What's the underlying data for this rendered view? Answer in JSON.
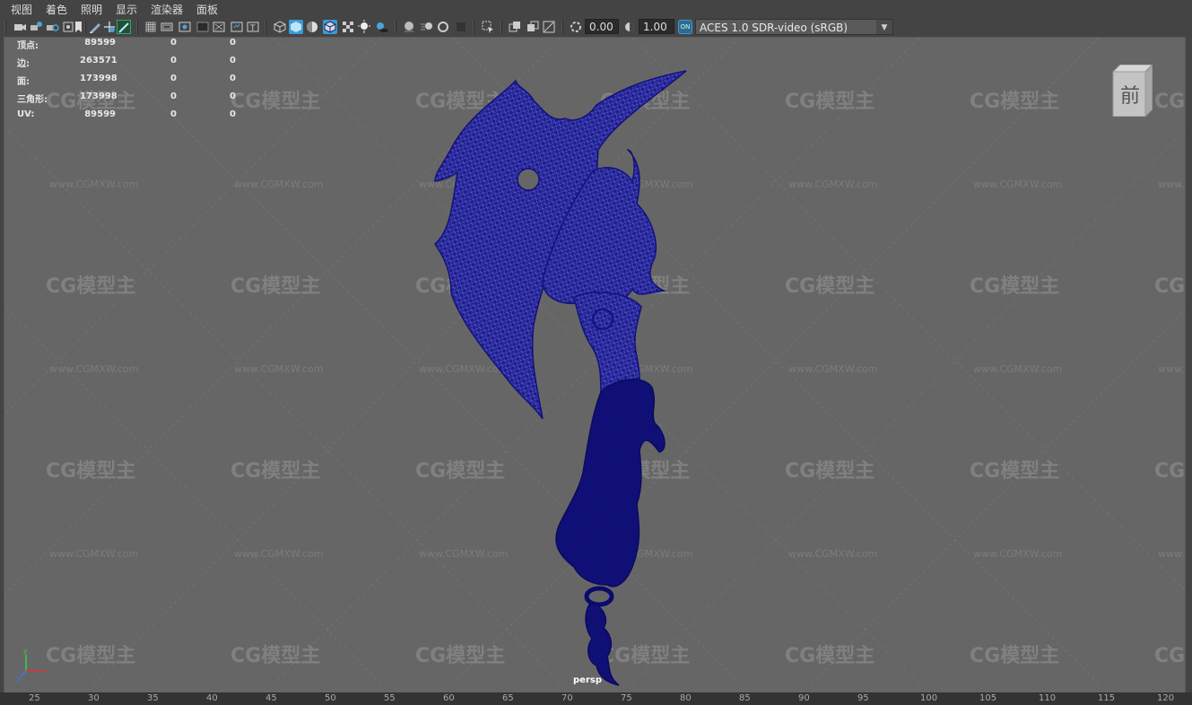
{
  "menu": [
    "视图",
    "着色",
    "照明",
    "显示",
    "渲染器",
    "面板"
  ],
  "toolbar": {
    "exposure": "0.00",
    "gamma": "1.00",
    "colorspace": "ACES 1.0 SDR-video (sRGB)",
    "on_badge": "ON"
  },
  "hud": [
    {
      "label": "顶点:",
      "values": [
        "89599",
        "0",
        "0"
      ]
    },
    {
      "label": "边:",
      "values": [
        "263571",
        "0",
        "0"
      ]
    },
    {
      "label": "面:",
      "values": [
        "173998",
        "0",
        "0"
      ]
    },
    {
      "label": "三角形:",
      "values": [
        "173998",
        "0",
        "0"
      ]
    },
    {
      "label": "UV:",
      "values": [
        "89599",
        "0",
        "0"
      ]
    }
  ],
  "view_cube": {
    "face_label": "前"
  },
  "camera": "persp",
  "watermark": {
    "logo": "CG模型主",
    "url": "www.CGMXW.com"
  },
  "axis": {
    "x": "x",
    "y": "y",
    "z": "z"
  },
  "ruler_ticks": [
    "25",
    "30",
    "35",
    "40",
    "45",
    "50",
    "55",
    "60",
    "65",
    "70",
    "75",
    "80",
    "85",
    "90",
    "95",
    "100",
    "105",
    "110",
    "115",
    "120"
  ],
  "colors": {
    "mesh": "#0d0d7a",
    "wire": "#2a2ab0",
    "viewport_bg": "#666666",
    "accent": "#3a9bd8"
  }
}
